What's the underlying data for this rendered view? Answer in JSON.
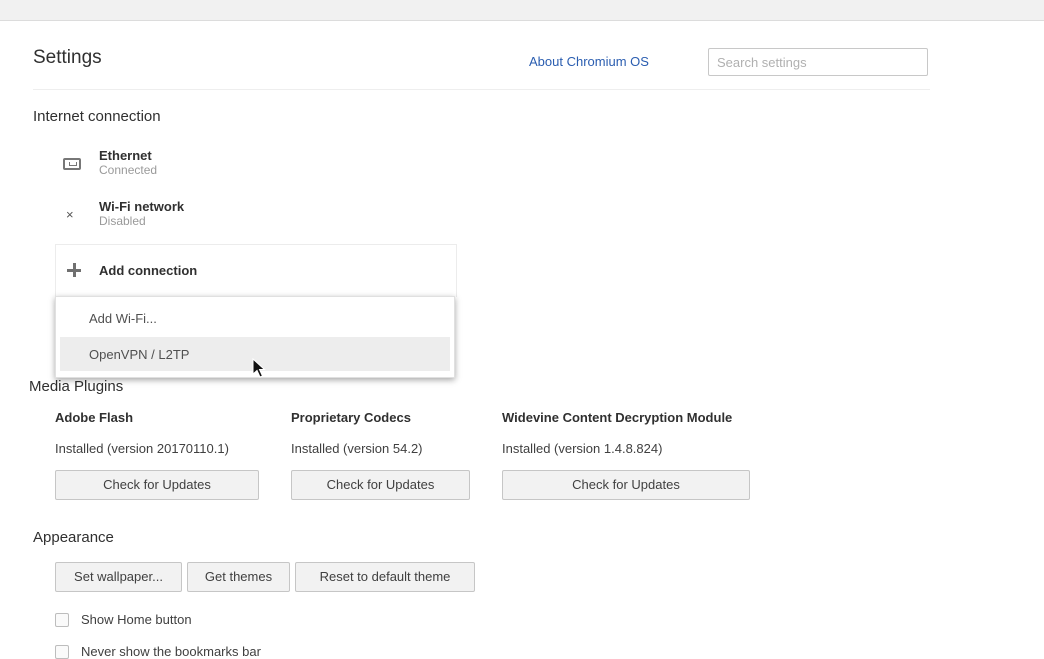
{
  "header": {
    "title": "Settings",
    "about_link": "About Chromium OS",
    "search_placeholder": "Search settings"
  },
  "internet": {
    "title": "Internet connection",
    "networks": [
      {
        "name": "Ethernet",
        "status": "Connected",
        "icon": "ethernet-icon"
      },
      {
        "name": "Wi-Fi network",
        "status": "Disabled",
        "icon": "wifi-disabled-icon"
      }
    ],
    "add_connection_label": "Add connection",
    "add_connection_menu": [
      "Add Wi-Fi...",
      "OpenVPN / L2TP"
    ],
    "hovered_menu_item": "OpenVPN / L2TP"
  },
  "media_plugins": {
    "title": "Media Plugins",
    "plugins": [
      {
        "name": "Adobe Flash",
        "version": "Installed (version 20170110.1)",
        "button": "Check for Updates"
      },
      {
        "name": "Proprietary Codecs",
        "version": "Installed (version 54.2)",
        "button": "Check for Updates"
      },
      {
        "name": "Widevine Content Decryption Module",
        "version": "Installed (version 1.4.8.824)",
        "button": "Check for Updates"
      }
    ]
  },
  "appearance": {
    "title": "Appearance",
    "buttons": [
      "Set wallpaper...",
      "Get themes",
      "Reset to default theme"
    ],
    "checkboxes": [
      {
        "label": "Show Home button",
        "checked": false
      },
      {
        "label": "Never show the bookmarks bar",
        "checked": false
      }
    ]
  },
  "colors": {
    "link": "#2a5db0",
    "menu_hover": "#ededed"
  }
}
